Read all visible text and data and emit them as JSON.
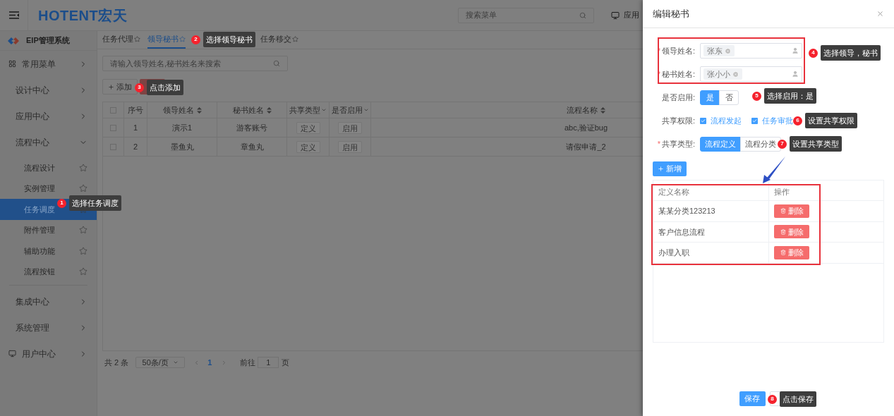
{
  "header": {
    "logo": "HOTENT宏天",
    "search": {
      "placeholder": "搜索菜单"
    },
    "app_link": "应用"
  },
  "sidebar": {
    "title": "EIP管理系统",
    "menu": [
      {
        "label": "常用菜单",
        "expanded": false
      },
      {
        "label": "设计中心",
        "expanded": false
      },
      {
        "label": "应用中心",
        "expanded": false
      },
      {
        "label": "流程中心",
        "expanded": true,
        "children": [
          {
            "label": "流程设计",
            "selected": false
          },
          {
            "label": "实例管理",
            "selected": false
          },
          {
            "label": "任务调度",
            "selected": true
          },
          {
            "label": "附件管理",
            "selected": false
          },
          {
            "label": "辅助功能",
            "selected": false
          },
          {
            "label": "流程按钮",
            "selected": false
          }
        ]
      },
      {
        "label": "集成中心",
        "expanded": false
      },
      {
        "label": "系统管理",
        "expanded": false
      },
      {
        "label": "用户中心",
        "expanded": false
      }
    ]
  },
  "tabs": [
    {
      "label": "任务代理",
      "selected": false
    },
    {
      "label": "领导秘书",
      "selected": true
    },
    {
      "label": "任务移交",
      "selected": false
    }
  ],
  "search": {
    "placeholder": "请输入领导姓名,秘书姓名来搜索"
  },
  "add_button": "添加",
  "table": {
    "select_all_checked": false,
    "columns": [
      {
        "label": "序号",
        "kind": "plain"
      },
      {
        "label": "领导姓名",
        "kind": "sort"
      },
      {
        "label": "秘书姓名",
        "kind": "sort"
      },
      {
        "label": "共享类型",
        "kind": "filter"
      },
      {
        "label": "是否启用",
        "kind": "filter"
      },
      {
        "label": "流程名称",
        "kind": "sort"
      }
    ],
    "rows": [
      {
        "checked": false,
        "cells": [
          "1",
          "演示1",
          "游客账号",
          "定义",
          "启用",
          "abc,验证bug"
        ]
      },
      {
        "checked": false,
        "cells": [
          "2",
          "墨鱼丸",
          "章鱼丸",
          "定义",
          "启用",
          "请假申请_2"
        ]
      }
    ]
  },
  "pagination": {
    "total": "共 2 条",
    "page_size": "50条/页",
    "current": "1",
    "goto_label": "前往",
    "goto_value": "1",
    "page_suffix": "页"
  },
  "drawer": {
    "title": "编辑秘书",
    "fields": [
      {
        "kind": "user",
        "label": "领导姓名:",
        "required_mark": "*",
        "tag": "张东"
      },
      {
        "kind": "user",
        "label": "秘书姓名:",
        "required_mark": "*",
        "tag": "张小小"
      },
      {
        "kind": "toggle",
        "label": "是否启用:",
        "options": [
          {
            "label": "是",
            "selected": true
          },
          {
            "label": "否",
            "selected": false
          }
        ]
      },
      {
        "kind": "checks",
        "label": "共享权限:",
        "options": [
          {
            "label": "流程发起",
            "checked": true
          },
          {
            "label": "任务审批",
            "checked": true
          }
        ]
      },
      {
        "kind": "toggle",
        "label": "共享类型:",
        "required_mark": "*",
        "options": [
          {
            "label": "流程定义",
            "selected": true
          },
          {
            "label": "流程分类",
            "selected": false
          }
        ]
      }
    ],
    "add_button": "新增",
    "table": {
      "columns": [
        "定义名称",
        "操作"
      ],
      "rows": [
        {
          "name": "某某分类123213",
          "action": "删除"
        },
        {
          "name": "客户信息流程",
          "action": "删除"
        },
        {
          "name": "办理入职",
          "action": "删除"
        }
      ]
    },
    "save_button": "保存"
  },
  "annotations": [
    {
      "number": "1",
      "text": "选择任务调度"
    },
    {
      "number": "2",
      "text": "选择领导秘书"
    },
    {
      "number": "3",
      "text": "点击添加"
    },
    {
      "number": "4",
      "text": "选择领导，秘书"
    },
    {
      "number": "5",
      "text": "选择启用：是"
    },
    {
      "number": "6",
      "text": "设置共享权限"
    },
    {
      "number": "7",
      "text": "设置共享类型"
    },
    {
      "number": "8",
      "text": "点击保存"
    }
  ]
}
